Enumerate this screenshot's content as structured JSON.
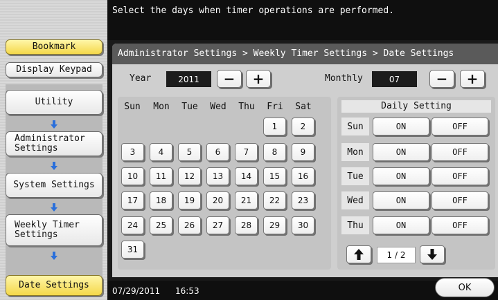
{
  "message": "Select the days when timer operations are performed.",
  "sidebar": {
    "bookmark": "Bookmark",
    "display_keypad": "Display Keypad",
    "nav": [
      "Utility",
      "Administrator Settings",
      "System Settings",
      "Weekly Timer Settings",
      "Date Settings"
    ]
  },
  "breadcrumb": "Administrator Settings > Weekly Timer Settings > Date Settings",
  "year": {
    "label": "Year",
    "value": "2011",
    "minus": "−",
    "plus": "+"
  },
  "monthly": {
    "label": "Monthly",
    "value": "07",
    "minus": "−",
    "plus": "+"
  },
  "calendar": {
    "weekdays": [
      "Sun",
      "Mon",
      "Tue",
      "Wed",
      "Thu",
      "Fri",
      "Sat"
    ],
    "days": [
      "1",
      "2",
      "3",
      "4",
      "5",
      "6",
      "7",
      "8",
      "9",
      "10",
      "11",
      "12",
      "13",
      "14",
      "15",
      "16",
      "17",
      "18",
      "19",
      "20",
      "21",
      "22",
      "23",
      "24",
      "25",
      "26",
      "27",
      "28",
      "29",
      "30",
      "31"
    ]
  },
  "daily": {
    "title": "Daily Setting",
    "rows": [
      {
        "day": "Sun",
        "on": "ON",
        "off": "OFF"
      },
      {
        "day": "Mon",
        "on": "ON",
        "off": "OFF"
      },
      {
        "day": "Tue",
        "on": "ON",
        "off": "OFF"
      },
      {
        "day": "Wed",
        "on": "ON",
        "off": "OFF"
      },
      {
        "day": "Thu",
        "on": "ON",
        "off": "OFF"
      }
    ],
    "page": "1 / 2"
  },
  "status": {
    "date": "07/29/2011",
    "time": "16:53"
  },
  "ok_label": "OK",
  "icons": [
    "arrow-down-icon",
    "arrow-up-icon",
    "minus-icon",
    "plus-icon"
  ],
  "colors": {
    "highlight": "#f4d84a",
    "nav_arrow": "#2a6fdb",
    "dark": "#1a1a1a"
  }
}
